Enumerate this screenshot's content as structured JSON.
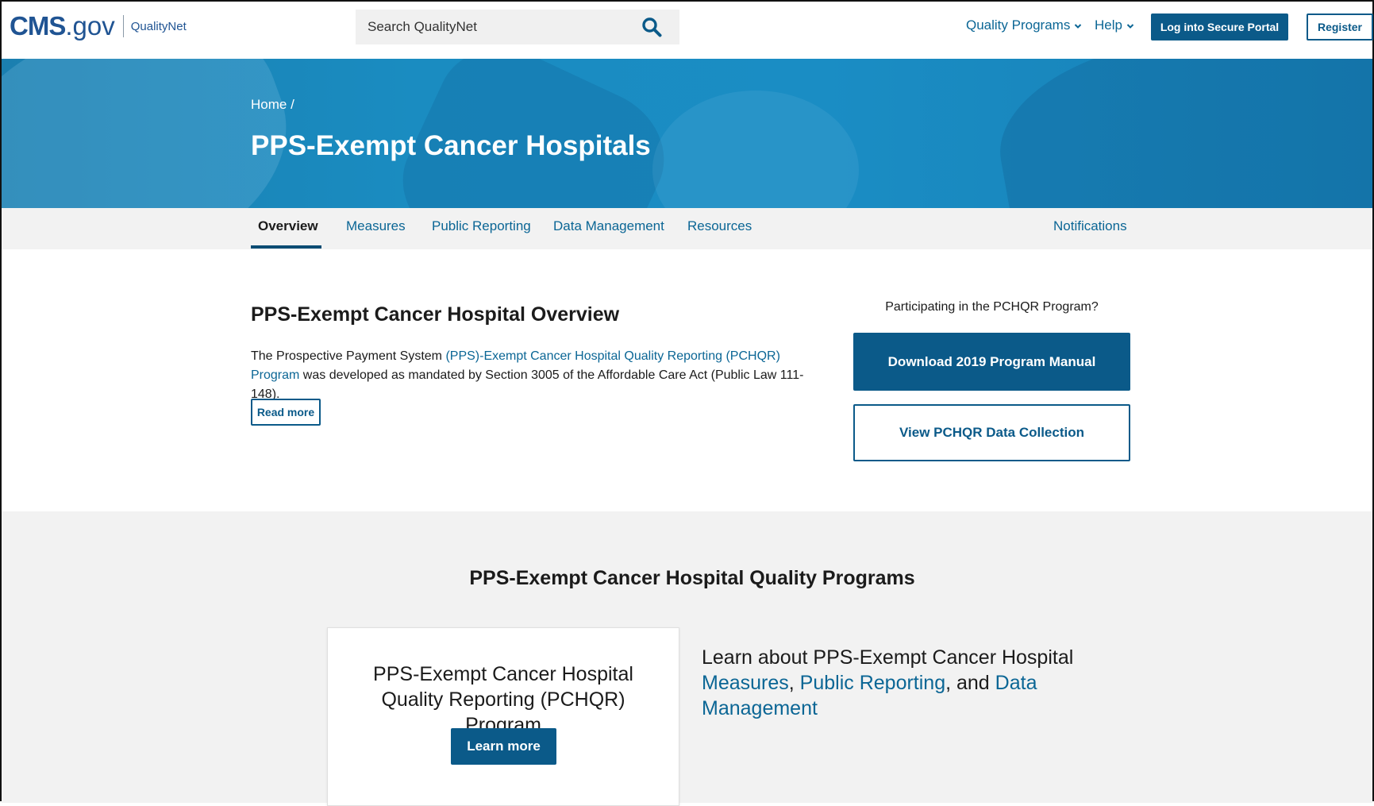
{
  "header": {
    "logo_cms": "CMS",
    "logo_gov": ".gov",
    "logo_site": "QualityNet",
    "search_placeholder": "Search QualityNet",
    "nav": {
      "quality_programs": "Quality Programs",
      "help": "Help"
    },
    "login_label": "Log into Secure Portal",
    "register_label": "Register"
  },
  "hero": {
    "breadcrumb": "Home /",
    "title": "PPS-Exempt Cancer Hospitals"
  },
  "tabs": [
    {
      "label": "Overview",
      "active": true
    },
    {
      "label": "Measures"
    },
    {
      "label": "Public Reporting"
    },
    {
      "label": "Data Management"
    },
    {
      "label": "Resources"
    },
    {
      "label": "Notifications"
    }
  ],
  "overview": {
    "title": "PPS-Exempt Cancer Hospital Overview",
    "text_before": "The Prospective Payment System ",
    "link": "(PPS)-Exempt Cancer Hospital Quality Reporting (PCHQR) Program",
    "text_after": " was developed as mandated by Section 3005 of the Affordable Care Act (Public Law 111-148).",
    "read_more": "Read more"
  },
  "sidebar": {
    "prompt": "Participating in the PCHQR Program?",
    "download_label": "Download 2019 Program Manual",
    "view_label": "View PCHQR Data Collection"
  },
  "programs": {
    "title": "PPS-Exempt Cancer Hospital Quality Programs",
    "card_title": "PPS-Exempt Cancer Hospital Quality Reporting (PCHQR) Program",
    "learn_more": "Learn more",
    "learn_prefix": "Learn about PPS-Exempt Cancer Hospital ",
    "link_measures": "Measures",
    "sep1": ", ",
    "link_public": "Public Reporting",
    "sep2": ", and ",
    "link_data": "Data Management"
  },
  "colors": {
    "brand": "#205493",
    "link": "#0b6695",
    "button": "#0b5a89",
    "hero": "#1a8dc4"
  }
}
